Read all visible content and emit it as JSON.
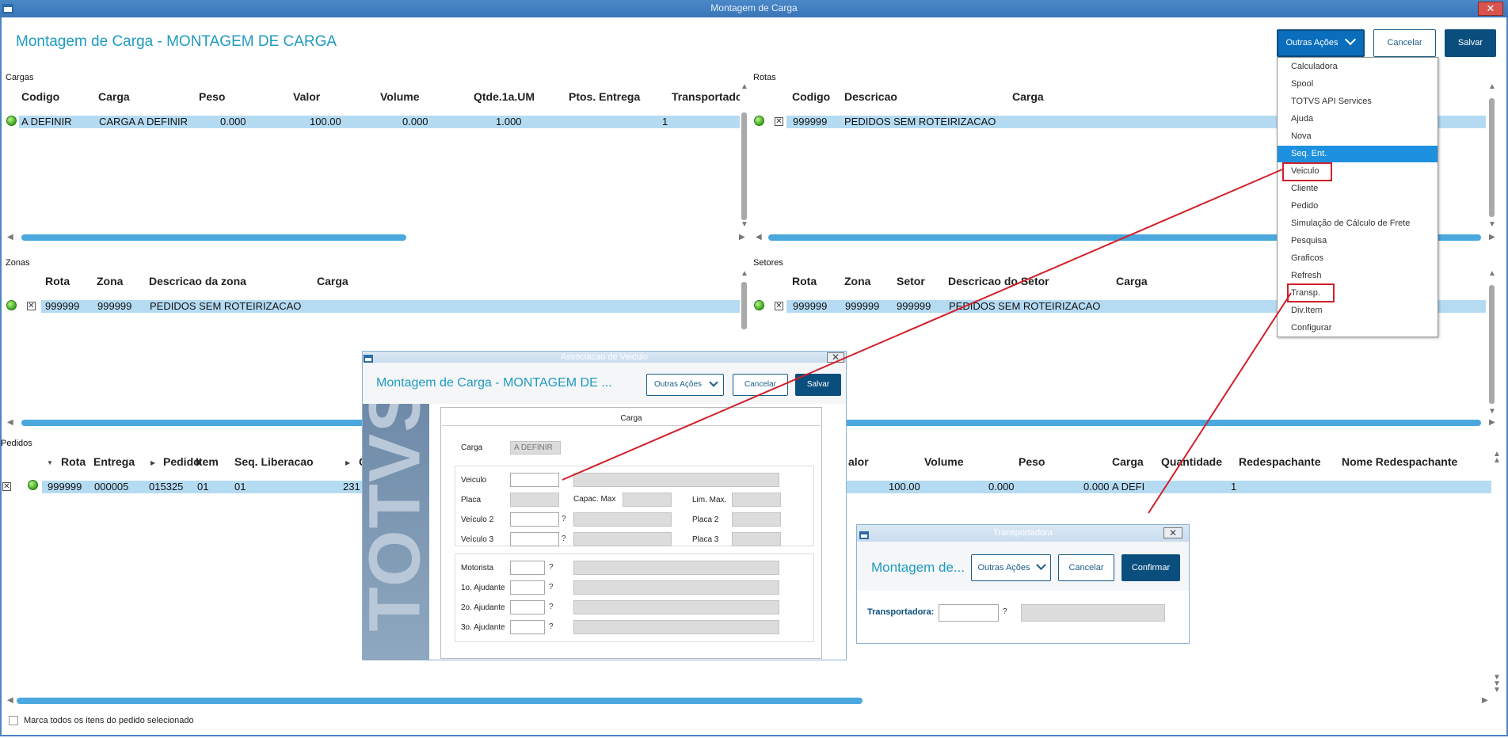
{
  "window": {
    "title": "Montagem de Carga"
  },
  "header": {
    "title": "Montagem de Carga - MONTAGEM DE CARGA",
    "outras_acoes": "Outras Ações",
    "cancelar": "Cancelar",
    "salvar": "Salvar"
  },
  "menu": {
    "items": [
      "Calculadora",
      "Spool",
      "TOTVS API Services",
      "Ajuda",
      "Nova",
      "Seq. Ent.",
      "Veiculo",
      "Cliente",
      "Pedido",
      "Simulação de Cálculo de Frete",
      "Pesquisa",
      "Graficos",
      "Refresh",
      "Transp.",
      "Div.Item",
      "Configurar"
    ],
    "highlighted": "Seq. Ent."
  },
  "cargas": {
    "label": "Cargas",
    "columns": [
      "Codigo",
      "Carga",
      "Peso",
      "Valor",
      "Volume",
      "Qtde.1a.UM",
      "Ptos. Entrega",
      "Transportado"
    ],
    "row": [
      "A DEFINIR",
      "CARGA A DEFINIR",
      "0.000",
      "100.00",
      "0.000",
      "1.000",
      "1"
    ]
  },
  "rotas": {
    "label": "Rotas",
    "columns": [
      "Codigo",
      "Descricao",
      "Carga"
    ],
    "row": [
      "999999",
      "PEDIDOS SEM ROTEIRIZACAO"
    ]
  },
  "zonas": {
    "label": "Zonas",
    "columns": [
      "Rota",
      "Zona",
      "Descricao da zona",
      "Carga"
    ],
    "row": [
      "999999",
      "999999",
      "PEDIDOS SEM ROTEIRIZACAO"
    ]
  },
  "setores": {
    "label": "Setores",
    "columns": [
      "Rota",
      "Zona",
      "Setor",
      "Descricao do Setor",
      "Carga"
    ],
    "row": [
      "999999",
      "999999",
      "999999",
      "PEDIDOS SEM ROTEIRIZACAO"
    ]
  },
  "pedidos": {
    "label": "Pedidos",
    "columns": [
      "Rota",
      "Entrega",
      "Pedido",
      "Item",
      "Seq. Liberacao",
      "C",
      "alor",
      "Volume",
      "Peso",
      "Carga",
      "Quantidade",
      "Redespachante",
      "Nome Redespachante"
    ],
    "row": [
      "999999",
      "000005",
      "015325",
      "01",
      "01",
      "231",
      "100.00",
      "0.000",
      "0.000",
      "A DEFI",
      "1"
    ]
  },
  "footer": {
    "checkbox_label": "Marca todos os itens do pedido selecionado"
  },
  "dialog_veiculo": {
    "title": "Associacao de Veiculo",
    "header_title": "Montagem de Carga - MONTAGEM DE ...",
    "outras_acoes": "Outras Ações",
    "cancelar": "Cancelar",
    "salvar": "Salvar",
    "tab": "Carga",
    "carga_label": "Carga",
    "carga_value": "A DEFINIR",
    "veiculo": "Veiculo",
    "placa": "Placa",
    "capac": "Capac. Max",
    "lim_max": "Lim. Max.",
    "veiculo2": "Veículo 2",
    "placa2": "Placa 2",
    "veiculo3": "Veículo 3",
    "placa3": "Placa 3",
    "motorista": "Motorista",
    "ajudante1": "1o. Ajudante",
    "ajudante2": "2o. Ajudante",
    "ajudante3": "3o. Ajudante",
    "q": "?",
    "watermark": "TOTVS"
  },
  "dialog_transp": {
    "title": "Transportadora",
    "header_title": "Montagem de...",
    "outras_acoes": "Outras Ações",
    "cancelar": "Cancelar",
    "confirmar": "Confirmar",
    "transportadora": "Transportadora:",
    "q": "?"
  },
  "colors": {
    "accent": "#1f9ac0",
    "primary": "#0a4e7e",
    "selection": "#b5dbf3",
    "highlight": "#1e90e0",
    "annotation": "#d0202a"
  }
}
